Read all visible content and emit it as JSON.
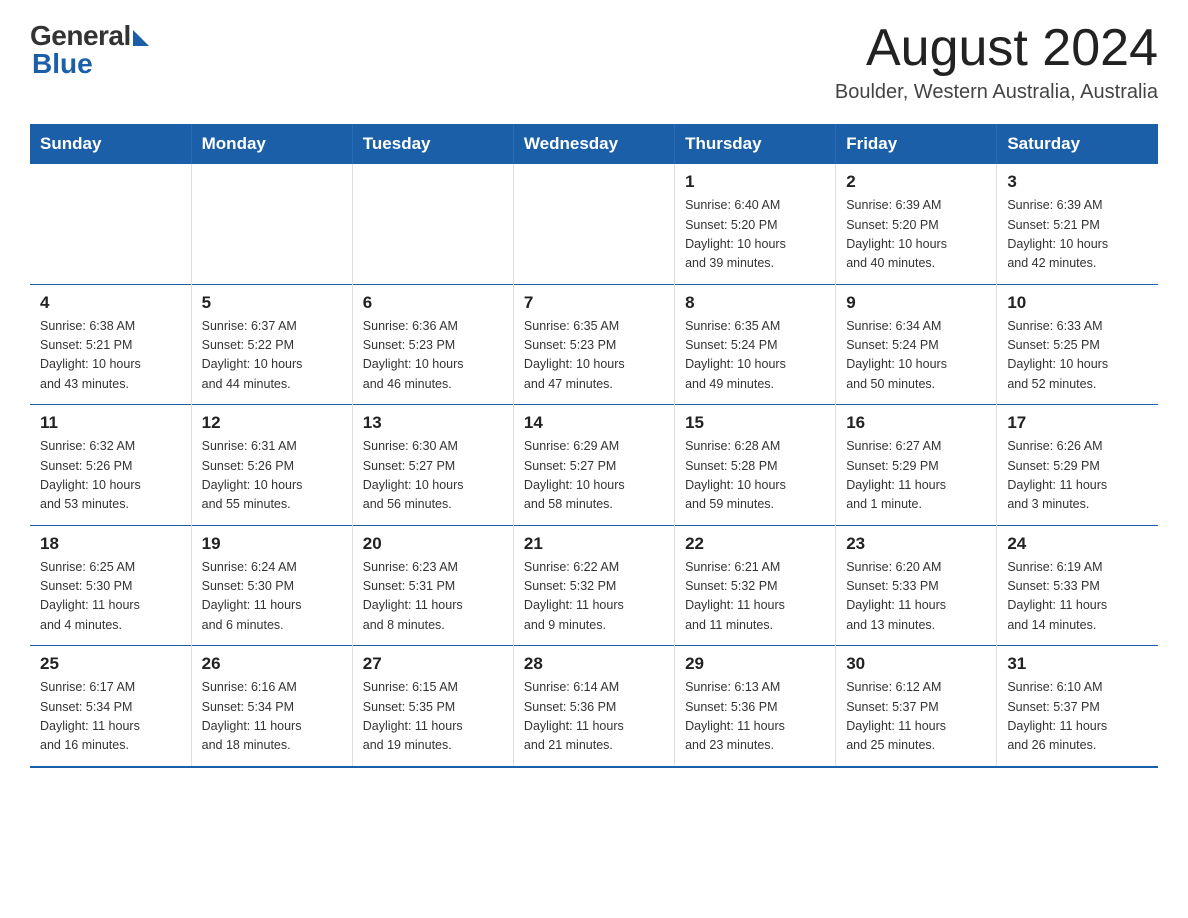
{
  "header": {
    "logo_general": "General",
    "logo_blue": "Blue",
    "title": "August 2024",
    "location": "Boulder, Western Australia, Australia"
  },
  "days_of_week": [
    "Sunday",
    "Monday",
    "Tuesday",
    "Wednesday",
    "Thursday",
    "Friday",
    "Saturday"
  ],
  "weeks": [
    {
      "days": [
        {
          "num": "",
          "info": ""
        },
        {
          "num": "",
          "info": ""
        },
        {
          "num": "",
          "info": ""
        },
        {
          "num": "",
          "info": ""
        },
        {
          "num": "1",
          "info": "Sunrise: 6:40 AM\nSunset: 5:20 PM\nDaylight: 10 hours\nand 39 minutes."
        },
        {
          "num": "2",
          "info": "Sunrise: 6:39 AM\nSunset: 5:20 PM\nDaylight: 10 hours\nand 40 minutes."
        },
        {
          "num": "3",
          "info": "Sunrise: 6:39 AM\nSunset: 5:21 PM\nDaylight: 10 hours\nand 42 minutes."
        }
      ]
    },
    {
      "days": [
        {
          "num": "4",
          "info": "Sunrise: 6:38 AM\nSunset: 5:21 PM\nDaylight: 10 hours\nand 43 minutes."
        },
        {
          "num": "5",
          "info": "Sunrise: 6:37 AM\nSunset: 5:22 PM\nDaylight: 10 hours\nand 44 minutes."
        },
        {
          "num": "6",
          "info": "Sunrise: 6:36 AM\nSunset: 5:23 PM\nDaylight: 10 hours\nand 46 minutes."
        },
        {
          "num": "7",
          "info": "Sunrise: 6:35 AM\nSunset: 5:23 PM\nDaylight: 10 hours\nand 47 minutes."
        },
        {
          "num": "8",
          "info": "Sunrise: 6:35 AM\nSunset: 5:24 PM\nDaylight: 10 hours\nand 49 minutes."
        },
        {
          "num": "9",
          "info": "Sunrise: 6:34 AM\nSunset: 5:24 PM\nDaylight: 10 hours\nand 50 minutes."
        },
        {
          "num": "10",
          "info": "Sunrise: 6:33 AM\nSunset: 5:25 PM\nDaylight: 10 hours\nand 52 minutes."
        }
      ]
    },
    {
      "days": [
        {
          "num": "11",
          "info": "Sunrise: 6:32 AM\nSunset: 5:26 PM\nDaylight: 10 hours\nand 53 minutes."
        },
        {
          "num": "12",
          "info": "Sunrise: 6:31 AM\nSunset: 5:26 PM\nDaylight: 10 hours\nand 55 minutes."
        },
        {
          "num": "13",
          "info": "Sunrise: 6:30 AM\nSunset: 5:27 PM\nDaylight: 10 hours\nand 56 minutes."
        },
        {
          "num": "14",
          "info": "Sunrise: 6:29 AM\nSunset: 5:27 PM\nDaylight: 10 hours\nand 58 minutes."
        },
        {
          "num": "15",
          "info": "Sunrise: 6:28 AM\nSunset: 5:28 PM\nDaylight: 10 hours\nand 59 minutes."
        },
        {
          "num": "16",
          "info": "Sunrise: 6:27 AM\nSunset: 5:29 PM\nDaylight: 11 hours\nand 1 minute."
        },
        {
          "num": "17",
          "info": "Sunrise: 6:26 AM\nSunset: 5:29 PM\nDaylight: 11 hours\nand 3 minutes."
        }
      ]
    },
    {
      "days": [
        {
          "num": "18",
          "info": "Sunrise: 6:25 AM\nSunset: 5:30 PM\nDaylight: 11 hours\nand 4 minutes."
        },
        {
          "num": "19",
          "info": "Sunrise: 6:24 AM\nSunset: 5:30 PM\nDaylight: 11 hours\nand 6 minutes."
        },
        {
          "num": "20",
          "info": "Sunrise: 6:23 AM\nSunset: 5:31 PM\nDaylight: 11 hours\nand 8 minutes."
        },
        {
          "num": "21",
          "info": "Sunrise: 6:22 AM\nSunset: 5:32 PM\nDaylight: 11 hours\nand 9 minutes."
        },
        {
          "num": "22",
          "info": "Sunrise: 6:21 AM\nSunset: 5:32 PM\nDaylight: 11 hours\nand 11 minutes."
        },
        {
          "num": "23",
          "info": "Sunrise: 6:20 AM\nSunset: 5:33 PM\nDaylight: 11 hours\nand 13 minutes."
        },
        {
          "num": "24",
          "info": "Sunrise: 6:19 AM\nSunset: 5:33 PM\nDaylight: 11 hours\nand 14 minutes."
        }
      ]
    },
    {
      "days": [
        {
          "num": "25",
          "info": "Sunrise: 6:17 AM\nSunset: 5:34 PM\nDaylight: 11 hours\nand 16 minutes."
        },
        {
          "num": "26",
          "info": "Sunrise: 6:16 AM\nSunset: 5:34 PM\nDaylight: 11 hours\nand 18 minutes."
        },
        {
          "num": "27",
          "info": "Sunrise: 6:15 AM\nSunset: 5:35 PM\nDaylight: 11 hours\nand 19 minutes."
        },
        {
          "num": "28",
          "info": "Sunrise: 6:14 AM\nSunset: 5:36 PM\nDaylight: 11 hours\nand 21 minutes."
        },
        {
          "num": "29",
          "info": "Sunrise: 6:13 AM\nSunset: 5:36 PM\nDaylight: 11 hours\nand 23 minutes."
        },
        {
          "num": "30",
          "info": "Sunrise: 6:12 AM\nSunset: 5:37 PM\nDaylight: 11 hours\nand 25 minutes."
        },
        {
          "num": "31",
          "info": "Sunrise: 6:10 AM\nSunset: 5:37 PM\nDaylight: 11 hours\nand 26 minutes."
        }
      ]
    }
  ]
}
